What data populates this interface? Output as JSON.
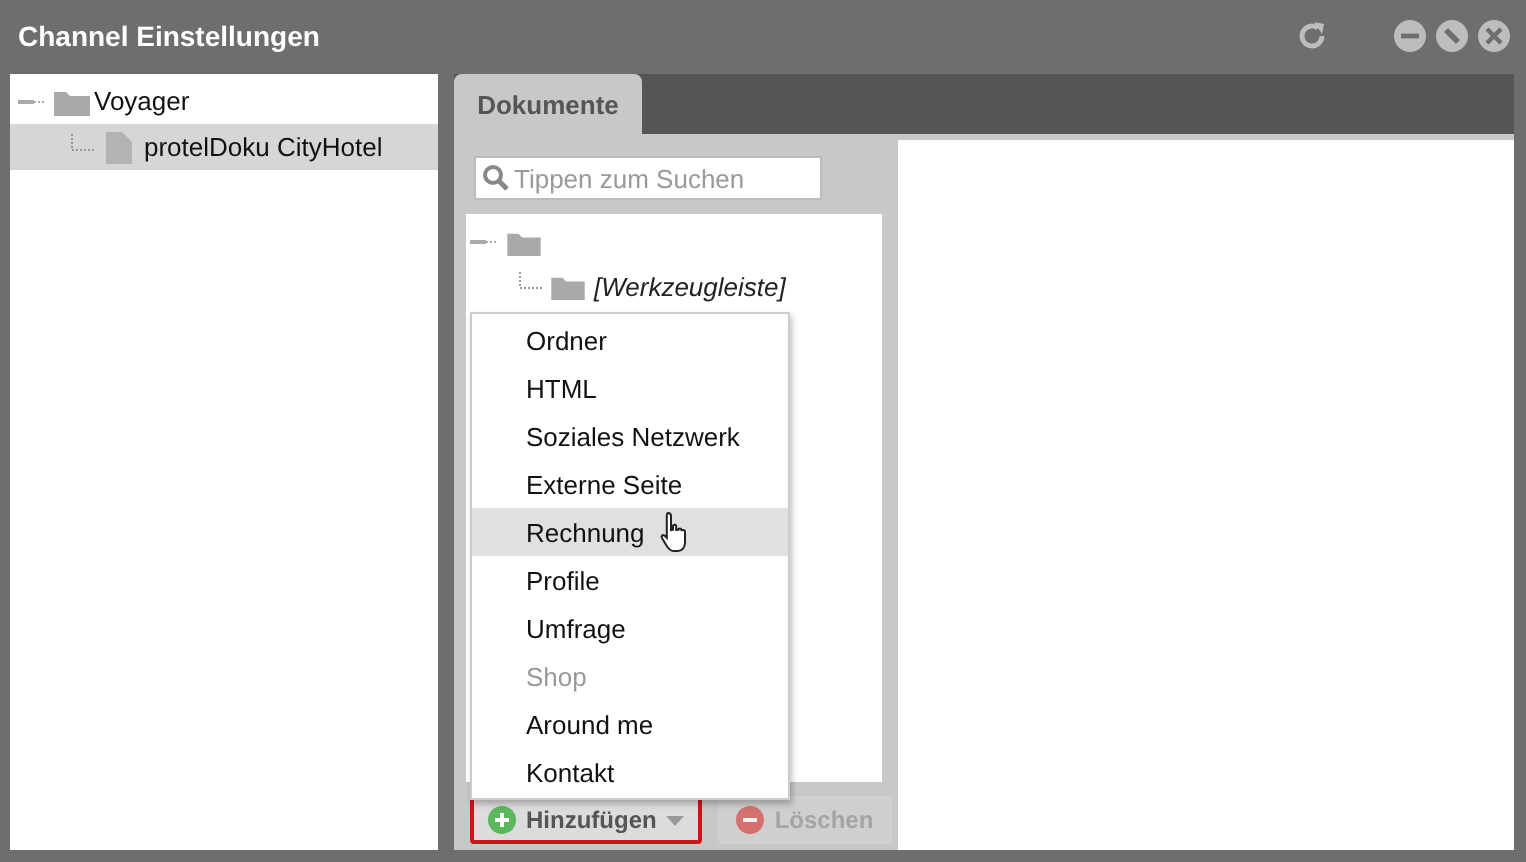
{
  "window": {
    "title": "Channel Einstellungen"
  },
  "channel_tree": [
    {
      "label": "Voyager",
      "kind": "folder",
      "selected": false,
      "children": [
        {
          "label": "protelDoku CityHotel",
          "kind": "document",
          "selected": true
        }
      ]
    }
  ],
  "tabs": [
    {
      "label": "Dokumente",
      "selected": true
    }
  ],
  "search": {
    "placeholder": "Tippen zum Suchen"
  },
  "document_tree": [
    {
      "kind": "folder",
      "children": [
        {
          "label": "[Werkzeugleiste]",
          "kind": "folder"
        }
      ]
    }
  ],
  "add_menu": [
    {
      "label": "Ordner",
      "hovered": false,
      "disabled": false
    },
    {
      "label": "HTML",
      "hovered": false,
      "disabled": false
    },
    {
      "label": "Soziales Netzwerk",
      "hovered": false,
      "disabled": false
    },
    {
      "label": "Externe Seite",
      "hovered": false,
      "disabled": false
    },
    {
      "label": "Rechnung",
      "hovered": true,
      "disabled": false
    },
    {
      "label": "Profile",
      "hovered": false,
      "disabled": false
    },
    {
      "label": "Umfrage",
      "hovered": false,
      "disabled": false
    },
    {
      "label": "Shop",
      "hovered": false,
      "disabled": true
    },
    {
      "label": "Around me",
      "hovered": false,
      "disabled": false
    },
    {
      "label": "Kontakt",
      "hovered": false,
      "disabled": false
    }
  ],
  "buttons": [
    {
      "label": "Hinzufügen",
      "kind": "add",
      "disabled": false,
      "highlighted": true
    },
    {
      "label": "Löschen",
      "kind": "delete",
      "disabled": true,
      "highlighted": false
    }
  ]
}
